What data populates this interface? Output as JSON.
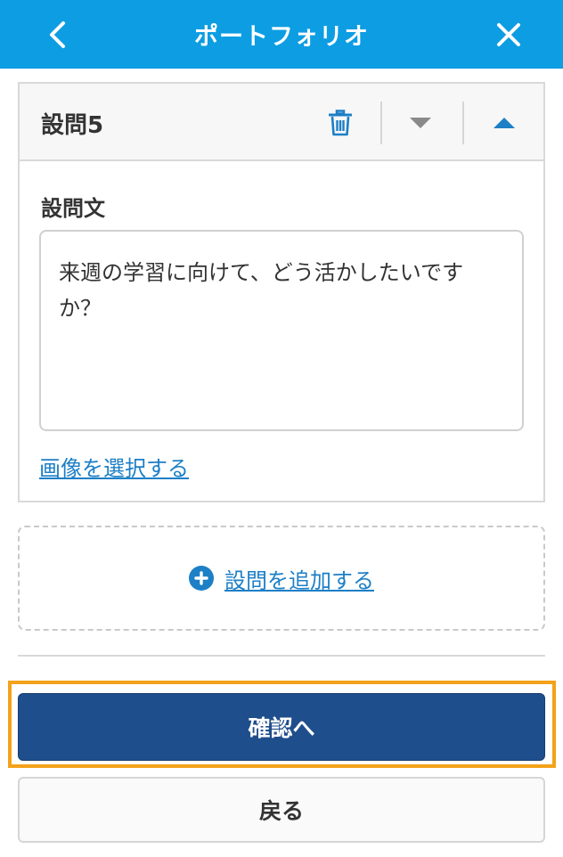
{
  "header": {
    "title": "ポートフォリオ",
    "back_icon": "chevron-left-icon",
    "close_icon": "close-icon"
  },
  "question": {
    "title": "設問5",
    "delete_icon": "trash-icon",
    "move_down_icon": "caret-down-icon",
    "move_up_icon": "caret-up-icon",
    "field_label": "設問文",
    "text_value": "来週の学習に向けて、どう活かしたいですか？",
    "image_link": "画像を選択する"
  },
  "add_question": {
    "label": "設問を追加する",
    "icon": "plus-circle-icon"
  },
  "footer": {
    "confirm_label": "確認へ",
    "back_label": "戻る"
  },
  "colors": {
    "header_bg": "#0d9de3",
    "link": "#1d7fc6",
    "primary_button": "#1f4e8c",
    "focus_ring": "#f3a21a"
  }
}
